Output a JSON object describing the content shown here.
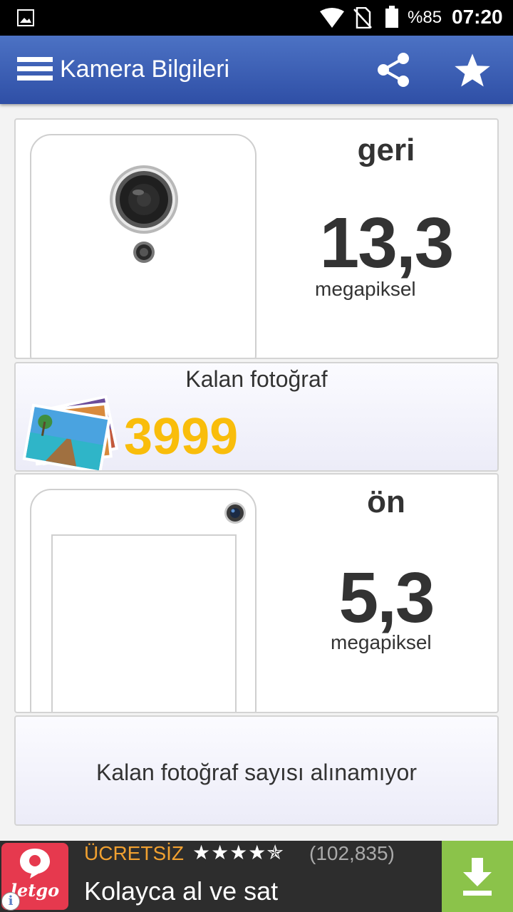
{
  "status_bar": {
    "battery": "%85",
    "time": "07:20"
  },
  "app_bar": {
    "title": "Kamera Bilgileri"
  },
  "back_camera": {
    "label": "geri",
    "megapixels": "13,3",
    "unit": "megapiksel"
  },
  "back_remaining": {
    "title": "Kalan fotoğraf",
    "count": "3999"
  },
  "front_camera": {
    "label": "ön",
    "megapixels": "5,3",
    "unit": "megapiksel"
  },
  "front_remaining": {
    "message": "Kalan fotoğraf sayısı alınamıyor"
  },
  "ad": {
    "logo_text": "letgo",
    "free_label": "ÜCRETSİZ",
    "rating_stars": "★★★★✯",
    "reviews": "(102,835)",
    "headline": "Kolayca al ve sat",
    "info_glyph": "i"
  },
  "colors": {
    "app_bar": "#3a5db5",
    "remaining_count": "#f9bd0b",
    "ad_logo": "#e6394e",
    "ad_download": "#8bc34a",
    "ad_free": "#f0a030"
  }
}
